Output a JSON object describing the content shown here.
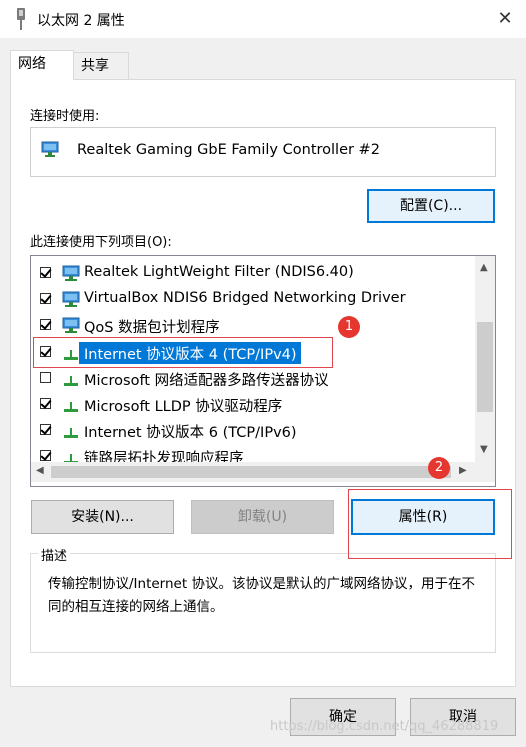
{
  "window": {
    "title": "以太网 2 属性"
  },
  "tabs": [
    {
      "label": "网络"
    },
    {
      "label": "共享"
    }
  ],
  "connect_using": {
    "label": "连接时使用:",
    "adapter": "Realtek Gaming GbE Family Controller #2",
    "configure_button": "配置(C)..."
  },
  "items_section": {
    "label": "此连接使用下列项目(O):",
    "items": [
      {
        "label": "Realtek LightWeight Filter (NDIS6.40)",
        "checked": true,
        "icon": "monitor-icon"
      },
      {
        "label": "VirtualBox NDIS6 Bridged Networking Driver",
        "checked": true,
        "icon": "monitor-icon"
      },
      {
        "label": "QoS 数据包计划程序",
        "checked": true,
        "icon": "monitor-icon"
      },
      {
        "label": "Internet 协议版本 4 (TCP/IPv4)",
        "checked": true,
        "icon": "protocol-icon",
        "selected": true
      },
      {
        "label": "Microsoft 网络适配器多路传送器协议",
        "checked": false,
        "icon": "protocol-icon"
      },
      {
        "label": "Microsoft LLDP 协议驱动程序",
        "checked": true,
        "icon": "protocol-icon"
      },
      {
        "label": "Internet 协议版本 6 (TCP/IPv6)",
        "checked": true,
        "icon": "protocol-icon"
      },
      {
        "label": "链路层拓扑发现响应程序",
        "checked": true,
        "icon": "protocol-icon"
      }
    ]
  },
  "buttons": {
    "install": "安装(N)...",
    "uninstall": "卸载(U)",
    "properties": "属性(R)",
    "ok": "确定",
    "cancel": "取消"
  },
  "description": {
    "legend": "描述",
    "text": "传输控制协议/Internet 协议。该协议是默认的广域网络协议，用于在不同的相互连接的网络上通信。"
  },
  "annotations": {
    "badge1": "1",
    "badge2": "2"
  },
  "watermark": "https://blog.csdn.net/qq_46288819",
  "colors": {
    "selection": "#0078d7",
    "annotation": "#e5362f",
    "panel": "#ffffff",
    "window_bg": "#f0f0f0"
  }
}
